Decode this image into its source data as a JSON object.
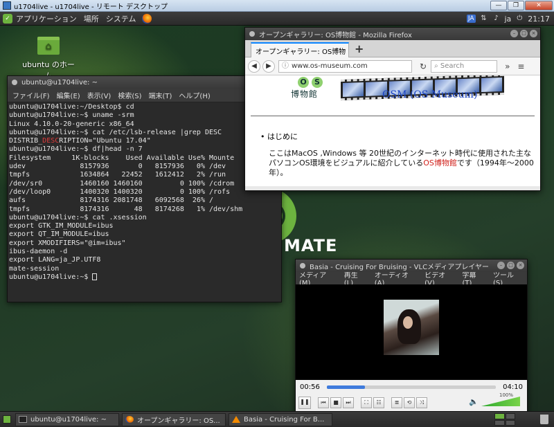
{
  "rdp": {
    "title": "u1704live - u1704live - リモート デスクトップ",
    "min": "—",
    "max": "❐",
    "close": "✕"
  },
  "top_panel": {
    "menus": [
      "アプリケーション",
      "場所",
      "システム"
    ],
    "lang_badge": "JA",
    "lang": "ja",
    "clock": "21:17"
  },
  "desktop": {
    "home_label": "ubuntu のホーム",
    "mate_label": "MATE"
  },
  "terminal": {
    "title": "ubuntu@u1704live: ~",
    "menu": [
      "ファイル(F)",
      "編集(E)",
      "表示(V)",
      "検索(S)",
      "端末(T)",
      "ヘルプ(H)"
    ],
    "lines": [
      "ubuntu@u1704live:~/Desktop$ cd",
      "ubuntu@u1704live:~$ uname -srm",
      "Linux 4.10.0-20-generic x86_64",
      "ubuntu@u1704live:~$ cat /etc/lsb-release |grep DESC"
    ],
    "distrib_pre": "DISTRIB_",
    "distrib_hl": "DESC",
    "distrib_post": "RIPTION=\"Ubuntu 17.04\"",
    "lines2": [
      "ubuntu@u1704live:~$ df|head -n 7",
      "Filesystem     1K-blocks    Used Available Use% Mounte",
      "udev             8157936       0   8157936   0% /dev",
      "tmpfs            1634864   22452   1612412   2% /run",
      "/dev/sr0         1460160 1460160         0 100% /cdrom",
      "/dev/loop0       1400320 1400320         0 100% /rofs",
      "aufs             8174316 2081748   6092568  26% /",
      "tmpfs            8174316      48   8174268   1% /dev/shm",
      "ubuntu@u1704live:~$ cat .xsession",
      "export GTK_IM_MODULE=ibus",
      "export QT_IM_MODULE=ibus",
      "export XMODIFIERS=\"@im=ibus\"",
      "ibus-daemon -d",
      "export LANG=ja_JP.UTF8",
      "mate-session"
    ],
    "prompt": "ubuntu@u1704live:~$ "
  },
  "firefox": {
    "title": "オープンギャラリー: OS博物館 - Mozilla Firefox",
    "tab_label": "オープンギャラリー: OS博物",
    "new_tab": "+",
    "url": "www.os-museum.com",
    "search_placeholder": "Search",
    "logo_o": "O",
    "logo_s": "S",
    "logo_kanji": "博物館",
    "site_title": "OSM (OS Museum)",
    "bullet": "はじめに",
    "para_pre": "ここはMacOS ,Windows 等 20世紀のインターネット時代に使用された主なパソコンOS環境をビジュアルに紹介している",
    "para_link": "OS博物館",
    "para_post": "です（1994年〜2000年）。"
  },
  "vlc": {
    "title": "Basia - Cruising For Bruising - VLCメディアプレイヤー",
    "menu": [
      "メディア (M)",
      "再生 (L)",
      "オーディオ (A)",
      "ビデオ (V)",
      "字幕 (T)",
      "ツール (S)"
    ],
    "elapsed": "00:56",
    "total": "04:10",
    "progress": 0.224,
    "volume": "100%"
  },
  "taskbar": {
    "tasks": [
      "ubuntu@u1704live: ~",
      "オープンギャラリー: OS...",
      "Basia - Cruising For B..."
    ]
  }
}
